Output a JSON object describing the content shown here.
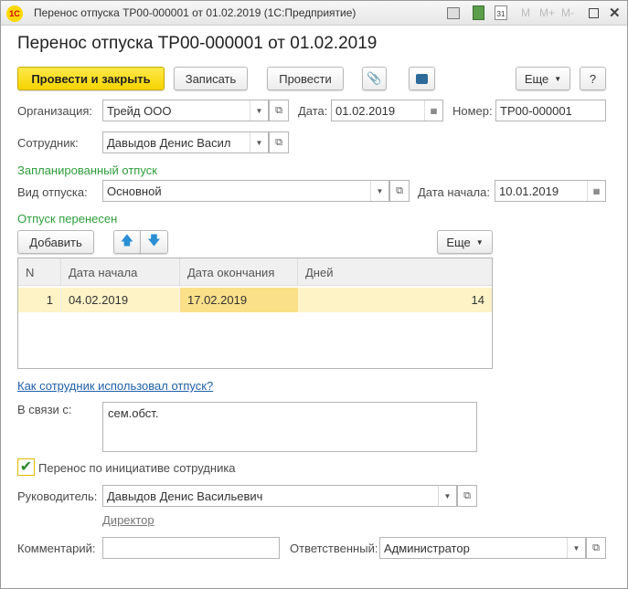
{
  "window": {
    "title": "Перенос отпуска ТР00-000001 от 01.02.2019  (1С:Предприятие)",
    "logo": "1С",
    "toolbar_icons": [
      "print-preview-icon",
      "calculator-icon",
      "calendar-icon"
    ],
    "memory_buttons": [
      "M",
      "M+",
      "M-"
    ]
  },
  "heading": "Перенос отпуска ТР00-000001 от 01.02.2019",
  "toolbar": {
    "post_close": "Провести и закрыть",
    "save": "Записать",
    "post": "Провести",
    "more": "Еще",
    "help": "?"
  },
  "form": {
    "org_label": "Организация:",
    "org_value": "Трейд ООО",
    "date_label": "Дата:",
    "date_value": "01.02.2019",
    "number_label": "Номер:",
    "number_value": "ТР00-000001",
    "employee_label": "Сотрудник:",
    "employee_value": "Давыдов Денис Васильевич",
    "planned_section": "Запланированный отпуск",
    "vac_type_label": "Вид отпуска:",
    "vac_type_value": "Основной",
    "start_label": "Дата начала:",
    "start_value": "10.01.2019",
    "moved_section": "Отпуск перенесен",
    "add_button": "Добавить",
    "table_more": "Еще",
    "table": {
      "columns": [
        "N",
        "Дата начала",
        "Дата окончания",
        "Дней"
      ],
      "rows": [
        {
          "n": "1",
          "start": "04.02.2019",
          "end": "17.02.2019",
          "days": "14"
        }
      ]
    },
    "usage_link": "Как сотрудник использовал отпуск?",
    "reason_label": "В связи с:",
    "reason_value": "сем.обст.",
    "initiative_label": "Перенос по инициативе сотрудника",
    "initiative_checked": true,
    "manager_label": "Руководитель:",
    "manager_value": "Давыдов Денис Васильевич",
    "manager_position": "Директор",
    "comment_label": "Комментарий:",
    "comment_value": "",
    "responsible_label": "Ответственный:",
    "responsible_value": "Администратор"
  }
}
